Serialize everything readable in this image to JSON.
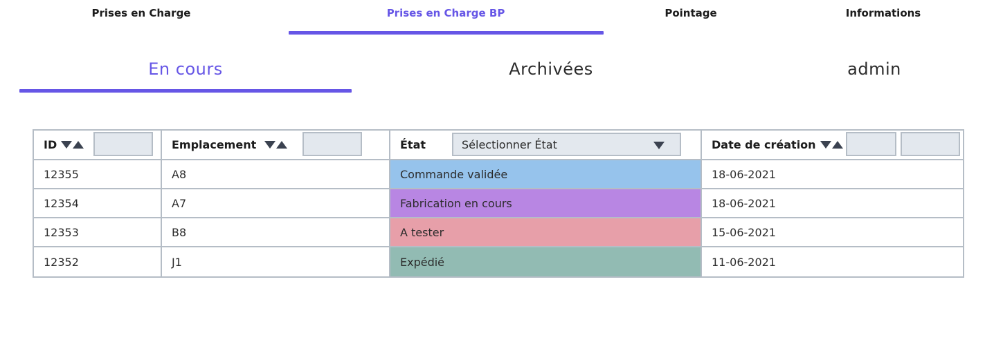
{
  "nav": {
    "tabs": [
      {
        "label": "Prises en Charge"
      },
      {
        "label": "Prises en Charge BP",
        "active": true
      },
      {
        "label": "Pointage"
      },
      {
        "label": "Informations"
      }
    ],
    "accent_color": "#6656e6"
  },
  "subnav": {
    "tabs": [
      {
        "label": "En cours",
        "active": true
      },
      {
        "label": "Archivées"
      },
      {
        "label": "admin"
      }
    ]
  },
  "table": {
    "columns": [
      {
        "label": "ID",
        "sortable": true
      },
      {
        "label": "Emplacement",
        "sortable": true
      },
      {
        "label": "État",
        "select_placeholder": "Sélectionner État"
      },
      {
        "label": "Date de création",
        "sortable": true
      }
    ],
    "rows": [
      {
        "id": "12355",
        "location": "A8",
        "state": "Commande validée",
        "state_color": "#96c3ec",
        "date": "18-06-2021"
      },
      {
        "id": "12354",
        "location": "A7",
        "state": "Fabrication en cours",
        "state_color": "#b886e3",
        "date": "18-06-2021"
      },
      {
        "id": "12353",
        "location": "B8",
        "state": "A tester",
        "state_color": "#e79fa9",
        "date": "15-06-2021"
      },
      {
        "id": "12352",
        "location": "J1",
        "state": "Expédié",
        "state_color": "#92bbb3",
        "date": "11-06-2021"
      }
    ]
  }
}
